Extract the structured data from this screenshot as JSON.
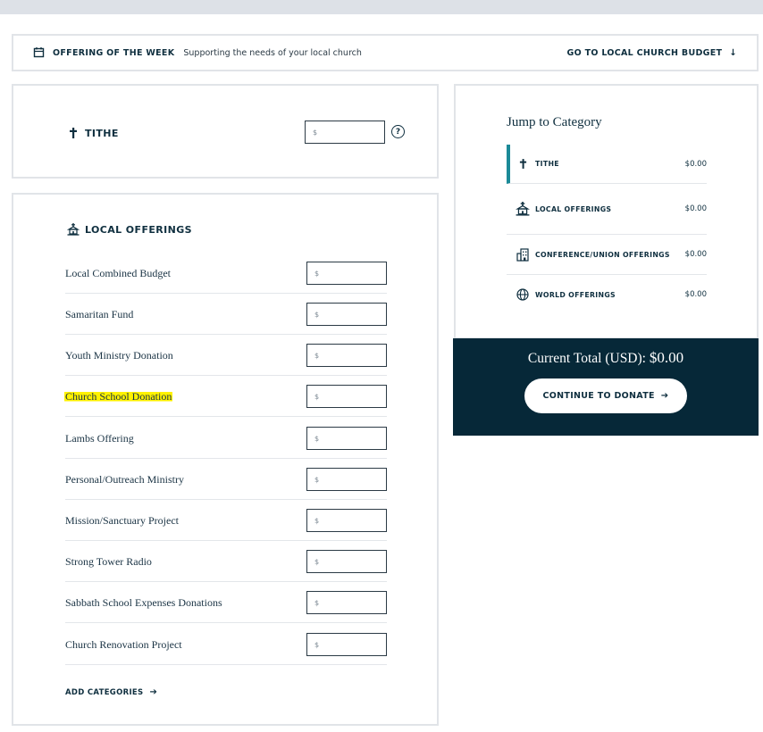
{
  "offering_of_week": {
    "title": "OFFERING OF THE WEEK",
    "subtitle": "Supporting the needs of your local church",
    "link_label": "GO TO LOCAL CHURCH BUDGET",
    "link_arrow": "↓"
  },
  "tithe": {
    "heading": "TITHE",
    "placeholder": "$",
    "help_label": "?"
  },
  "local_offerings": {
    "heading": "LOCAL OFFERINGS",
    "placeholder": "$",
    "items": [
      {
        "label": "Local Combined Budget"
      },
      {
        "label": "Samaritan Fund"
      },
      {
        "label": "Youth Ministry Donation"
      },
      {
        "label": "Church School Donation"
      },
      {
        "label": "Lambs Offering"
      },
      {
        "label": "Personal/Outreach Ministry"
      },
      {
        "label": "Mission/Sanctuary Project"
      },
      {
        "label": "Strong Tower Radio"
      },
      {
        "label": "Sabbath School Expenses Donations"
      },
      {
        "label": "Church Renovation Project"
      }
    ],
    "add_label": "ADD CATEGORIES",
    "add_arrow": "➔"
  },
  "jump": {
    "title": "Jump to Category",
    "items": [
      {
        "label": "TITHE",
        "value": "$0.00",
        "icon": "cross-icon"
      },
      {
        "label": "LOCAL OFFERINGS",
        "value": "$0.00",
        "icon": "church-icon"
      },
      {
        "label": "CONFERENCE/UNION OFFERINGS",
        "value": "$0.00",
        "icon": "building-icon"
      },
      {
        "label": "WORLD OFFERINGS",
        "value": "$0.00",
        "icon": "globe-icon"
      }
    ]
  },
  "total": {
    "label": "Current Total (USD):",
    "value": "$0.00",
    "button_label": "CONTINUE TO DONATE",
    "button_arrow": "➔"
  },
  "colors": {
    "navy": "#062838",
    "text": "#0f2f3f",
    "accent": "#1b8a98",
    "highlight": "#fff200",
    "border": "#e1e4e8"
  }
}
